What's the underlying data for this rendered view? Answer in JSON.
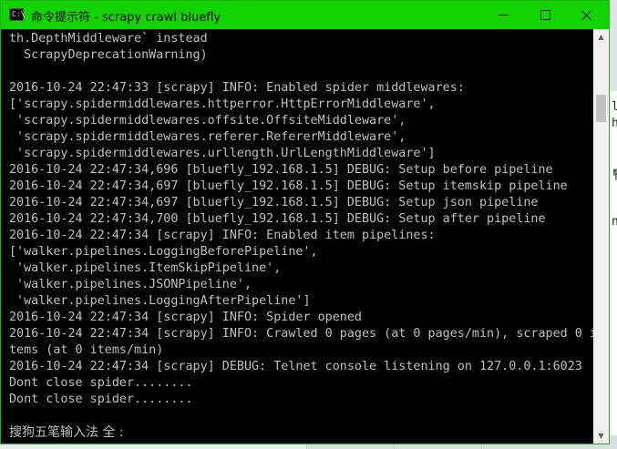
{
  "window": {
    "title": "命令提示符 - scrapy  crawl bluefly",
    "icon": "cmd-icon",
    "icon_prompt": "C:\\",
    "frame_color": "#13d400"
  },
  "controls": {
    "minimize": "minimize",
    "maximize": "maximize",
    "close": "close"
  },
  "console": {
    "lines": [
      "th.DepthMiddleware` instead",
      "  ScrapyDeprecationWarning)",
      "",
      "2016-10-24 22:47:33 [scrapy] INFO: Enabled spider middlewares:",
      "['scrapy.spidermiddlewares.httperror.HttpErrorMiddleware',",
      " 'scrapy.spidermiddlewares.offsite.OffsiteMiddleware',",
      " 'scrapy.spidermiddlewares.referer.RefererMiddleware',",
      " 'scrapy.spidermiddlewares.urllength.UrlLengthMiddleware']",
      "2016-10-24 22:47:34,696 [bluefly_192.168.1.5] DEBUG: Setup before pipeline",
      "2016-10-24 22:47:34,697 [bluefly_192.168.1.5] DEBUG: Setup itemskip pipeline",
      "2016-10-24 22:47:34,697 [bluefly_192.168.1.5] DEBUG: Setup json pipeline",
      "2016-10-24 22:47:34,700 [bluefly_192.168.1.5] DEBUG: Setup after pipeline",
      "2016-10-24 22:47:34 [scrapy] INFO: Enabled item pipelines:",
      "['walker.pipelines.LoggingBeforePipeline',",
      " 'walker.pipelines.ItemSkipPipeline',",
      " 'walker.pipelines.JSONPipeline',",
      " 'walker.pipelines.LoggingAfterPipeline']",
      "2016-10-24 22:47:34 [scrapy] INFO: Spider opened",
      "2016-10-24 22:47:34 [scrapy] INFO: Crawled 0 pages (at 0 pages/min), scraped 0 i",
      "tems (at 0 items/min)",
      "2016-10-24 22:47:34 [scrapy] DEBUG: Telnet console listening on 127.0.0.1:6023",
      "Dont close spider........",
      "Dont close spider........",
      ""
    ],
    "ime_status": "搜狗五笔输入法 全 :",
    "text_color": "#c0c0c0",
    "background": "#000000"
  },
  "scrollbar": {
    "up_icon": "▲",
    "down_icon": "▼"
  },
  "background_window": {
    "fragments": [
      "lo",
      "ha",
      "",
      "",
      "r",
      "ト",
      "",
      "",
      "nt"
    ]
  }
}
